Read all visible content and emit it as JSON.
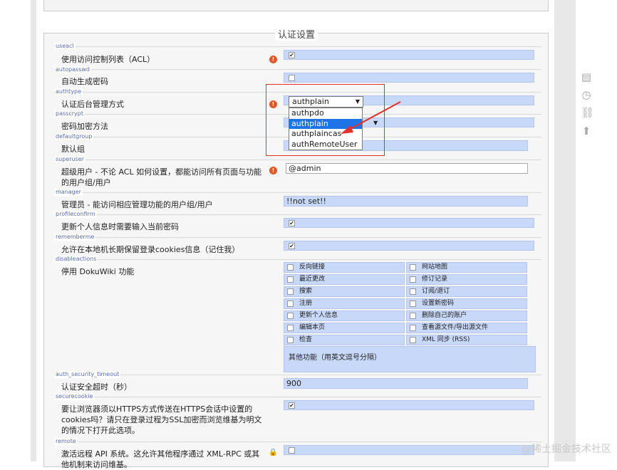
{
  "section": {
    "title": "认证设置"
  },
  "settings": {
    "useacl": {
      "key": "useacl",
      "label": "使用访问控制列表（ACL）",
      "checked": true
    },
    "autopasswd": {
      "key": "autopasswd",
      "label": "自动生成密码",
      "checked": false
    },
    "authtype": {
      "key": "authtype",
      "label": "认证后台管理方式",
      "selected": "authplain",
      "options": [
        "authpdo",
        "authplain",
        "authplaincas",
        "authRemoteUser"
      ]
    },
    "passcrypt": {
      "key": "passcrypt",
      "label": "密码加密方法"
    },
    "defaultgroup": {
      "key": "defaultgroup",
      "label": "默认组"
    },
    "superuser": {
      "key": "superuser",
      "label": "超级用户 - 不论 ACL 如何设置，都能访问所有页面与功能的用户组/用户",
      "value": "@admin"
    },
    "manager": {
      "key": "manager",
      "label": "管理员 - 能访问相应管理功能的用户组/用户",
      "value": "!!not set!!"
    },
    "profileconfirm": {
      "key": "profileconfirm",
      "label": "更新个人信息时需要输入当前密码",
      "checked": true
    },
    "rememberme": {
      "key": "rememberme",
      "label": "允许在本地机长期保留登录cookies信息（记住我）",
      "checked": true
    },
    "disableactions": {
      "key": "disableactions",
      "label": "停用 DokuWiki 功能",
      "left": [
        "反向链接",
        "最近更改",
        "搜索",
        "注册",
        "更新个人信息",
        "编辑本页",
        "检查"
      ],
      "right": [
        "网站地图",
        "修订记录",
        "订阅/退订",
        "设置新密码",
        "删除自己的账户",
        "查看源文件/导出源文件",
        "XML 同步 (RSS)"
      ],
      "other_label": "其他功能（用英文逗号分隔）"
    },
    "auth_security_timeout": {
      "key": "auth_security_timeout",
      "label": "认证安全超时（秒）",
      "value": "900"
    },
    "securecookie": {
      "key": "securecookie",
      "label": "要让浏览器须以HTTPS方式传送在HTTPS会话中设置的cookies吗？请只在登录过程为SSL加密而浏览维基为明文的情况下打开此选项。",
      "checked": true
    },
    "remote": {
      "key": "remote",
      "label": "激活远程 API 系统。这允许其他程序通过 XML-RPC 或其他机制来访问维基。"
    }
  },
  "side_icons": [
    "document-icon",
    "history-icon",
    "link-icon",
    "up-arrow-icon"
  ],
  "watermark": "@稀土掘金技术社区",
  "colors": {
    "value_bg": "#c8d8f8",
    "warning": "#e0572a",
    "highlight": "#e3322c",
    "select_highlight": "#1e73e8"
  }
}
